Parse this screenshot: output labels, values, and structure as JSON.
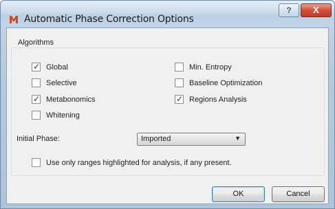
{
  "window": {
    "title": "Automatic Phase Correction Options",
    "help_label": "?",
    "close_label": "X"
  },
  "algorithms": {
    "group_label": "Algorithms",
    "options": [
      {
        "label": "Global",
        "checked": true
      },
      {
        "label": "Selective",
        "checked": false
      },
      {
        "label": "Metabonomics",
        "checked": true
      },
      {
        "label": "Whitening",
        "checked": false
      },
      {
        "label": "Min. Entropy",
        "checked": false
      },
      {
        "label": "Baseline Optimization",
        "checked": false
      },
      {
        "label": "Regions Analysis",
        "checked": true
      }
    ]
  },
  "initial_phase": {
    "label": "Initial Phase:",
    "selected": "Imported"
  },
  "ranges_option": {
    "label": "Use only ranges highlighted for analysis, if any present.",
    "checked": false
  },
  "buttons": {
    "ok": "OK",
    "cancel": "Cancel"
  },
  "colors": {
    "titlebar": "#c3d5e8",
    "close_button": "#c94630",
    "client_bg": "#f0f0f0",
    "default_button_border": "#3c7fb1"
  }
}
